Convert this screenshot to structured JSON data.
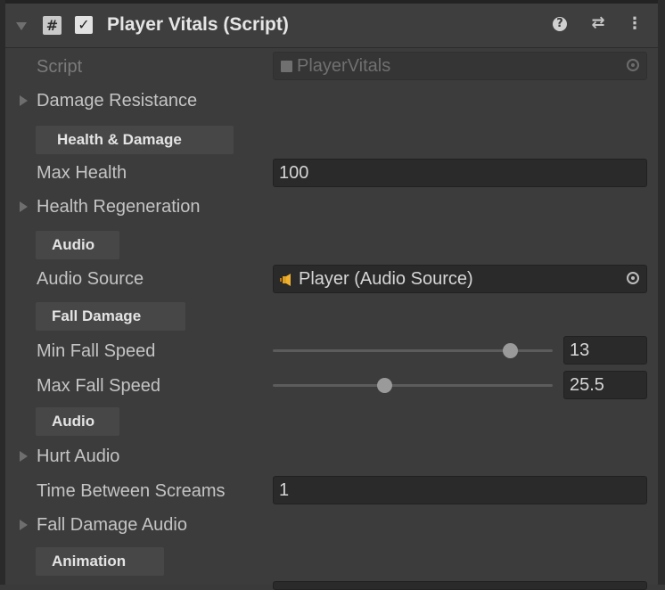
{
  "header": {
    "title": "Player Vitals (Script)",
    "enabled": true,
    "icons": [
      "foldout-arrow-icon",
      "script-hash-icon",
      "checkbox-icon",
      "help-icon",
      "presets-icon",
      "context-menu-icon"
    ]
  },
  "script": {
    "label": "Script",
    "value": "PlayerVitals"
  },
  "damage_resistance": {
    "label": "Damage Resistance"
  },
  "health_damage_header": "Health & Damage",
  "max_health": {
    "label": "Max Health",
    "value": "100"
  },
  "health_regeneration": {
    "label": "Health Regeneration"
  },
  "audio_header_1": "Audio",
  "audio_source": {
    "label": "Audio Source",
    "value": "Player (Audio Source)"
  },
  "fall_damage_header": "Fall Damage",
  "min_fall_speed": {
    "label": "Min Fall Speed",
    "value": "13",
    "slider_fraction": 0.85
  },
  "max_fall_speed": {
    "label": "Max Fall Speed",
    "value": "25.5",
    "slider_fraction": 0.4
  },
  "audio_header_2": "Audio",
  "hurt_audio": {
    "label": "Hurt Audio"
  },
  "time_between_screams": {
    "label": "Time Between Screams",
    "value": "1"
  },
  "fall_damage_audio": {
    "label": "Fall Damage Audio"
  },
  "animation_header": "Animation",
  "colors": {
    "panel_bg": "#3c3c3c",
    "field_bg": "#2a2a2a",
    "text": "#c4c4c4",
    "section_bg": "#474747"
  }
}
